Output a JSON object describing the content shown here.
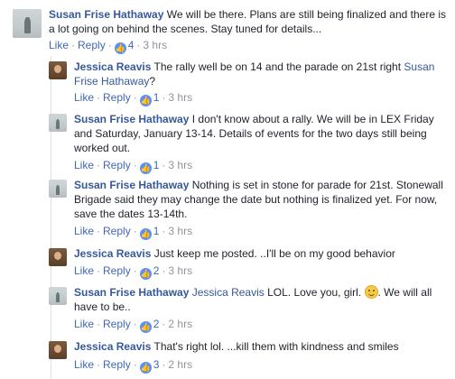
{
  "actions": {
    "like": "Like",
    "reply": "Reply"
  },
  "comments": [
    {
      "author": "Susan Frise Hathaway",
      "text": "We will be there. Plans are still being finalized and there is a lot going on behind the scenes. Stay tuned for details...",
      "likes": "4",
      "time": "3 hrs"
    },
    {
      "author": "Jessica Reavis",
      "text": "The rally well be on 14 and the parade on 21st right",
      "mention": "Susan Frise Hathaway",
      "text_after": "?",
      "likes": "1",
      "time": "3 hrs"
    },
    {
      "author": "Susan Frise Hathaway",
      "text": "I don't know about a rally. We will be in LEX Friday and Saturday, January 13-14. Details of events for the two days still being worked out.",
      "likes": "1",
      "time": "3 hrs"
    },
    {
      "author": "Susan Frise Hathaway",
      "text": "Nothing is set in stone for parade for 21st. Stonewall Brigade said they may change the date but nothing is finalized yet. For now, save the dates 13-14th.",
      "likes": "1",
      "time": "3 hrs"
    },
    {
      "author": "Jessica Reavis",
      "text": "Just keep me posted. ..I'll be on my good behavior",
      "likes": "2",
      "time": "3 hrs"
    },
    {
      "author": "Susan Frise Hathaway",
      "mention": "Jessica Reavis",
      "text": "LOL. Love you, girl.",
      "text_after": ". We will all have to be..",
      "likes": "2",
      "time": "2 hrs"
    },
    {
      "author": "Jessica Reavis",
      "text": "That's right lol. ...kill them with kindness and smiles",
      "likes": "3",
      "time": "2 hrs"
    }
  ]
}
